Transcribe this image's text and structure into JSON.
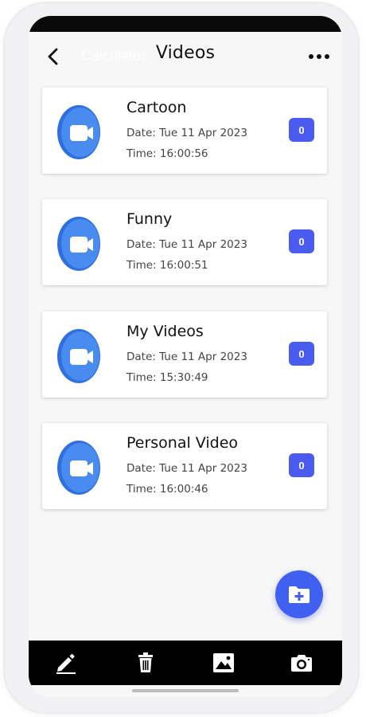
{
  "header": {
    "back_icon": "chevron-left-icon",
    "ghost_text": "Calculator",
    "title": "Videos",
    "more_icon": "more-horizontal-icon"
  },
  "folders": [
    {
      "name": "Cartoon",
      "date": "Date: Tue 11 Apr 2023",
      "time": "Time: 16:00:56",
      "count": "0"
    },
    {
      "name": "Funny",
      "date": "Date: Tue 11 Apr 2023",
      "time": "Time: 16:00:51",
      "count": "0"
    },
    {
      "name": "My Videos",
      "date": "Date: Tue 11 Apr 2023",
      "time": "Time: 15:30:49",
      "count": "0"
    },
    {
      "name": "Personal Video",
      "date": "Date: Tue 11 Apr 2023",
      "time": "Time: 16:00:46",
      "count": "0"
    }
  ],
  "fab": {
    "icon": "add-folder-icon"
  },
  "bottom_bar": {
    "items": [
      "edit-icon",
      "trash-icon",
      "image-icon",
      "camera-icon"
    ]
  },
  "colors": {
    "accent": "#4a5cf0",
    "fab": "#4060f2",
    "video_icon": "#3f7be8",
    "bar": "#000000"
  }
}
